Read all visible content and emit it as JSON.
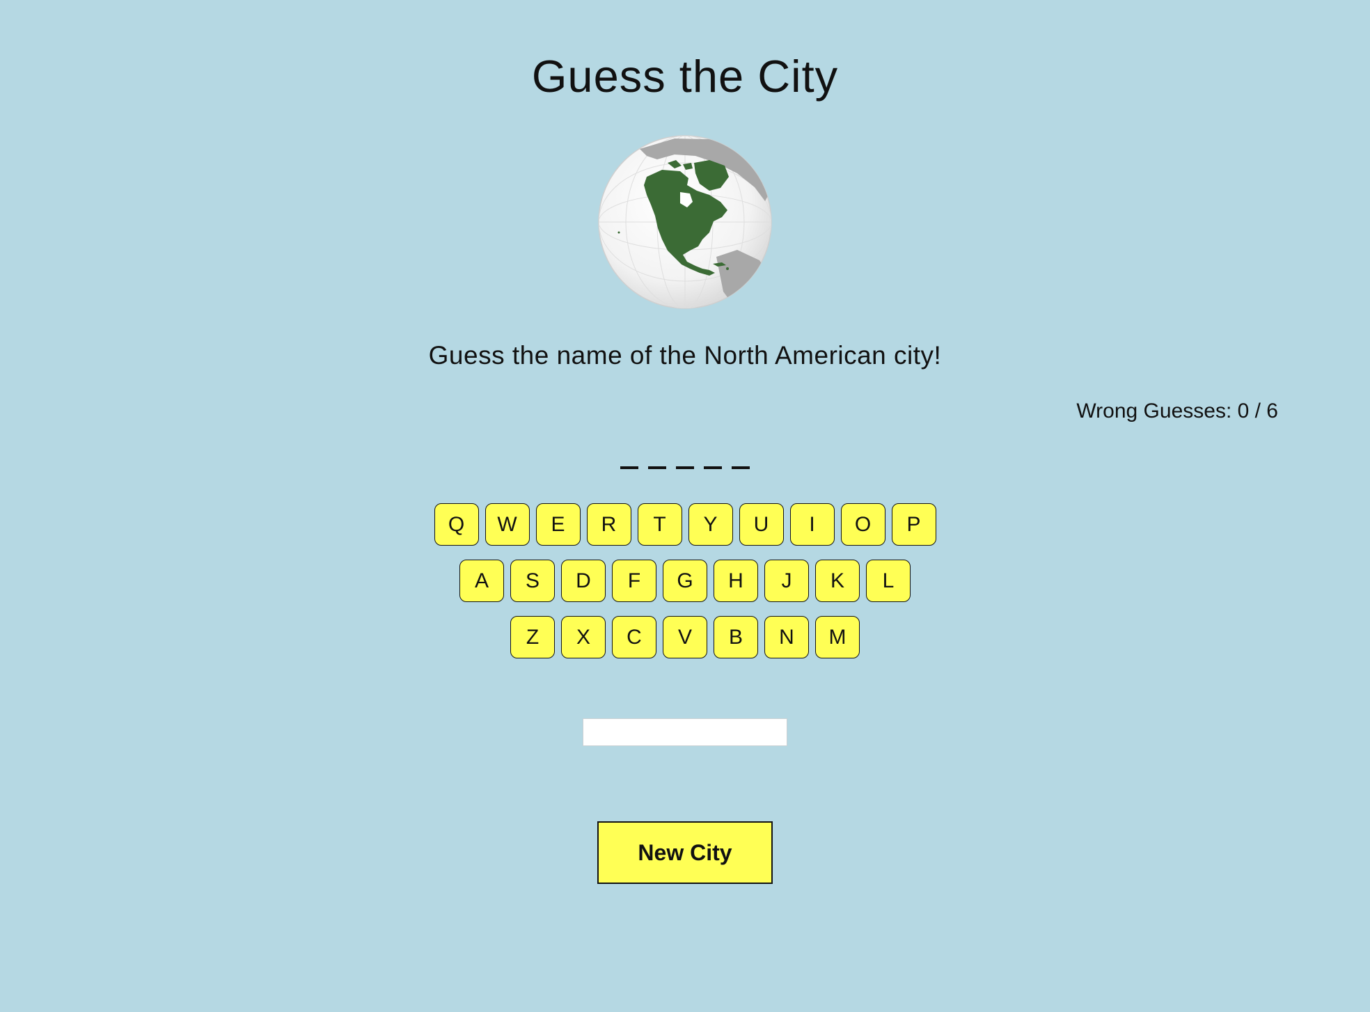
{
  "game": {
    "title": "Guess the City",
    "prompt": "Guess the name of the North American city!",
    "wrong_guesses_label": "Wrong Guesses: 0 / 6",
    "wrong_guesses": 0,
    "max_wrong_guesses": 6,
    "word_blanks": [
      "_",
      "_",
      "_",
      "_",
      "_"
    ],
    "guess_input_value": "",
    "new_city_label": "New City"
  },
  "keyboard": {
    "row1": [
      "Q",
      "W",
      "E",
      "R",
      "T",
      "Y",
      "U",
      "I",
      "O",
      "P"
    ],
    "row2": [
      "A",
      "S",
      "D",
      "F",
      "G",
      "H",
      "J",
      "K",
      "L"
    ],
    "row3": [
      "Z",
      "X",
      "C",
      "V",
      "B",
      "N",
      "M"
    ]
  },
  "colors": {
    "background": "#b5d8e3",
    "key_fill": "#ffff55",
    "globe_land": "#3b6b35"
  },
  "icons": {
    "globe": "north-america-globe-icon"
  }
}
